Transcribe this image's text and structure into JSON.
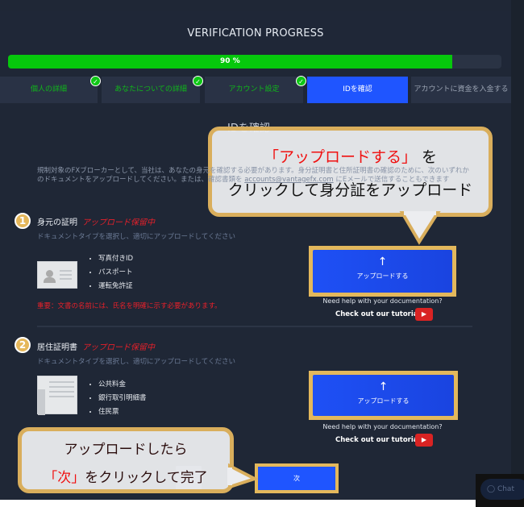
{
  "progress": {
    "title": "VERIFICATION PROGRESS",
    "percent": 90,
    "label": "90 %"
  },
  "tabs": [
    {
      "label": "個人の詳細",
      "done": true
    },
    {
      "label": "あなたについての詳細",
      "done": true
    },
    {
      "label": "アカウント設定",
      "done": true
    },
    {
      "label": "IDを確認",
      "active": true
    },
    {
      "label": "アカウントに資金を入金する"
    }
  ],
  "page_title": "IDを確認",
  "intro": {
    "text1": "規制対象のFXブローカーとして、当社は、あなたの身元を確認する必要があります。身分証明書と住所証明書の確認のために、次のいずれかのドキュメントをアップロードしてください。または、確認書類を ",
    "email": "accounts@vantagefx.com",
    "text2": " にEメールで送信することもできます"
  },
  "sections": [
    {
      "num": "1",
      "title": "身元の証明",
      "status": "アップロード保留中",
      "sub": "ドキュメントタイプを選択し、適切にアップロードしてください",
      "items": [
        "写真付きID",
        "パスポート",
        "運転免許証"
      ],
      "warning": "重要：文書の名前には、氏名を明確に示す必要があります。",
      "upload": "アップロードする",
      "help": "Need help with your documentation?",
      "tutorial": "Check out our tutorial"
    },
    {
      "num": "2",
      "title": "居住証明書",
      "status": "アップロード保留中",
      "sub": "ドキュメントタイプを選択し、適切にアップロードしてください",
      "items": [
        "公共料金",
        "銀行取引明細書",
        "住民票"
      ],
      "upload": "アップロードする",
      "help": "Need help with your documentation?",
      "tutorial": "Check out our tutorial"
    }
  ],
  "next_label": "次",
  "chat_label": "Chat",
  "callout1": {
    "q": "「アップロードする」",
    "a": "を",
    "line2": "クリックして身分証をアップロード"
  },
  "callout2": {
    "line1": "アップロードしたら",
    "q": "「次」",
    "rest": "をクリックして完了"
  },
  "colors": {
    "accent": "#1f55ff",
    "success": "#06c80c",
    "pending": "#e8202a",
    "highlight": "#e3b85c"
  }
}
